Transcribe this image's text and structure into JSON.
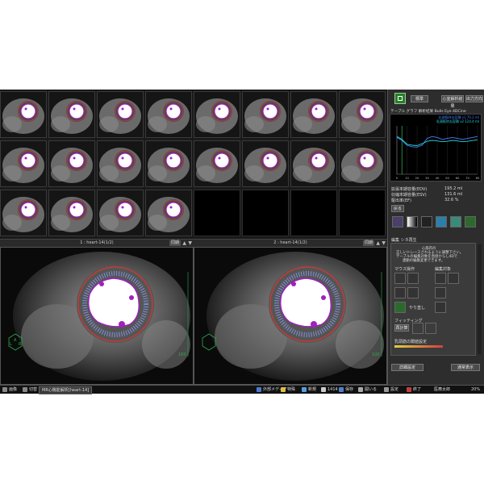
{
  "viewer": {
    "pane1_label": "1 : heart-14(1/2)",
    "pane2_label": "2 : heart-14(1/2)",
    "sync_button": "同期",
    "orient": {
      "a": "A",
      "l": "L",
      "r": "R",
      "p": "P"
    },
    "scale_text": "100"
  },
  "right": {
    "mode_select": "標準",
    "analysis_button": "心室解析結果",
    "output_button": "出力方向",
    "panel_tabs": "テーブル グラフ 解析結果 Bulls Eye 4DCine",
    "legend_line1": "乳頭筋除去容積 ν1 70.2 ml",
    "legend_line2": "乳頭筋除去容積 ν2 124.4 ml",
    "result_label1": "拡張末期容量(EDV)",
    "result_val1": "195.2 ml",
    "result_label2": "収縮末期容量(ESV)",
    "result_val2": "131.6 ml",
    "result_label3": "駆出率(EF)",
    "result_val3": "32.6 %",
    "back_button": "戻る",
    "edit_tabs": "編集 シネ再生",
    "instruction1": "心筋内の",
    "instruction2": "正しいトレースされるように調整下さい。",
    "instruction3": "テーブルの編集対象を直接からし4Dで",
    "instruction4": "連動の編集変更できます。",
    "mouse_ops": "マウス操作",
    "edit_target": "編集対象",
    "redo_label": "やり直し",
    "fitting_label": "フィッティング",
    "reset_button": "再計算",
    "papillary_settings": "乳頭筋の閾値設定",
    "detail_button": "詳細設定",
    "display_select": "通常表示"
  },
  "status": {
    "item1": "画像",
    "item2": "切替",
    "app_title": "MR心機能解析[heart-14]",
    "item_ext": "外部メディア",
    "item_special": "特殊",
    "item_new": "新規",
    "item_1414": "1414",
    "item_save": "保存",
    "item_all": "開いる",
    "item_setting": "設定",
    "item_end": "終了",
    "item_user": "医療太郎",
    "item_zoom": "20%"
  },
  "chart_data": {
    "type": "line",
    "x": [
      0,
      5,
      10,
      15,
      20,
      25,
      30,
      35,
      40,
      45,
      50,
      55,
      60,
      65,
      70,
      75,
      80
    ],
    "xlim": [
      0,
      80
    ],
    "ylim": [
      0,
      250
    ],
    "xticks": [
      0,
      10,
      20,
      30,
      40,
      50,
      60,
      70,
      80
    ],
    "series": [
      {
        "color": "#4f7bff",
        "values": [
          190,
          175,
          150,
          142,
          140,
          150,
          185,
          195,
          190,
          180,
          185,
          190,
          185,
          180,
          185,
          190,
          195
        ]
      },
      {
        "color": "#22d3d3",
        "values": [
          195,
          180,
          155,
          150,
          148,
          158,
          170,
          175,
          172,
          168,
          170,
          175,
          172,
          168,
          170,
          174,
          178
        ]
      }
    ]
  }
}
